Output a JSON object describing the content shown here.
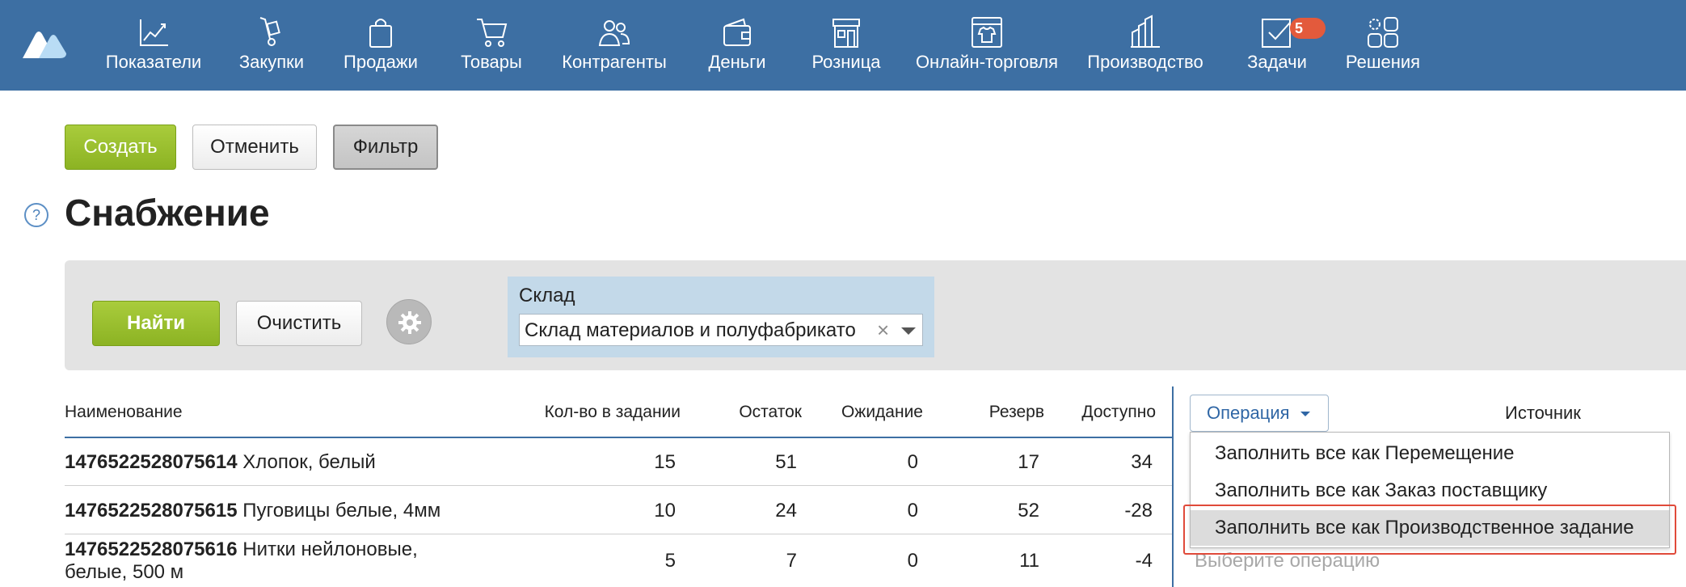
{
  "nav": {
    "items": [
      {
        "label": "Показатели",
        "icon": "chart-line-icon"
      },
      {
        "label": "Закупки",
        "icon": "hand-truck-icon"
      },
      {
        "label": "Продажи",
        "icon": "shopping-bag-icon"
      },
      {
        "label": "Товары",
        "icon": "cart-icon"
      },
      {
        "label": "Контрагенты",
        "icon": "people-icon"
      },
      {
        "label": "Деньги",
        "icon": "wallet-icon"
      },
      {
        "label": "Розница",
        "icon": "store-icon"
      },
      {
        "label": "Онлайн-торговля",
        "icon": "online-shop-icon"
      },
      {
        "label": "Производство",
        "icon": "factory-icon"
      },
      {
        "label": "Задачи",
        "icon": "tasks-check-icon",
        "badge": "5"
      },
      {
        "label": "Решения",
        "icon": "apps-grid-icon"
      }
    ]
  },
  "toolbar": {
    "create_label": "Создать",
    "cancel_label": "Отменить",
    "filter_label": "Фильтр"
  },
  "page": {
    "help": "?",
    "title": "Снабжение"
  },
  "filter": {
    "find_label": "Найти",
    "clear_label": "Очистить",
    "warehouse_label": "Склад",
    "warehouse_value": "Склад материалов и полуфабрикато",
    "warehouse_clear": "×"
  },
  "table": {
    "columns": [
      "Наименование",
      "Кол-во в задании",
      "Остаток",
      "Ожидание",
      "Резерв",
      "Доступно"
    ],
    "operation_button": "Операция",
    "source_header": "Источник",
    "rows": [
      {
        "code": "1476522528075614",
        "name": "Хлопок, белый",
        "qty": "15",
        "stock": "51",
        "waiting": "0",
        "reserve": "17",
        "available": "34"
      },
      {
        "code": "1476522528075615",
        "name": "Пуговицы белые, 4мм",
        "qty": "10",
        "stock": "24",
        "waiting": "0",
        "reserve": "52",
        "available": "-28"
      },
      {
        "code": "1476522528075616",
        "name": "Нитки нейлоновые,",
        "name2": "белые, 500 м",
        "qty": "5",
        "stock": "7",
        "waiting": "0",
        "reserve": "11",
        "available": "-4"
      }
    ],
    "operation_placeholder": "Выберите операцию"
  },
  "dropdown": {
    "items": [
      "Заполнить все как Перемещение",
      "Заполнить все как Заказ поставщику",
      "Заполнить все как Производственное задание"
    ]
  },
  "colors": {
    "topbar": "#3d6fa3",
    "accent_green": "#9ac031",
    "badge": "#e35a3c",
    "highlight_border": "#e04a3a"
  }
}
